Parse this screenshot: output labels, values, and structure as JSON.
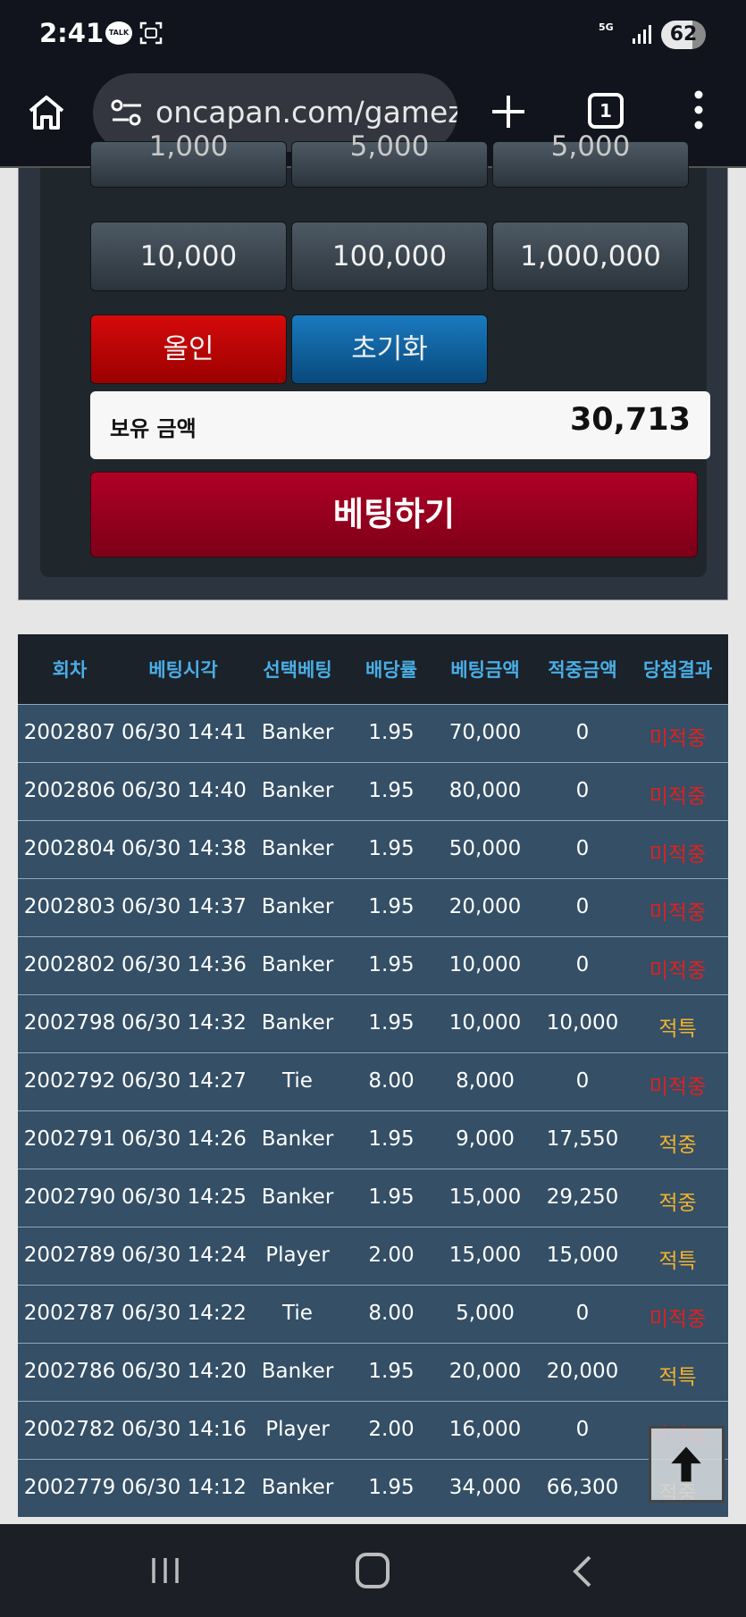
{
  "status_bar": {
    "time": "2:41",
    "talk_badge": "TALK",
    "network": "5G",
    "battery": "62"
  },
  "browser": {
    "url": "oncapan.com/gamez",
    "tab_count": "1"
  },
  "bet_panel": {
    "chip_top_row": [
      "1,000",
      "5,000",
      "5,000"
    ],
    "chip_row": [
      "10,000",
      "100,000",
      "1,000,000"
    ],
    "allin_label": "올인",
    "reset_label": "초기화",
    "balance_label": "보유 금액",
    "balance_value": "30,713",
    "bet_button_label": "베팅하기"
  },
  "history": {
    "columns": [
      "회차",
      "베팅시각",
      "선택베팅",
      "배당률",
      "베팅금액",
      "적중금액",
      "당첨결과"
    ],
    "rows": [
      [
        "2002807",
        "06/30 14:41",
        "Banker",
        "1.95",
        "70,000",
        "0",
        "미적중"
      ],
      [
        "2002806",
        "06/30 14:40",
        "Banker",
        "1.95",
        "80,000",
        "0",
        "미적중"
      ],
      [
        "2002804",
        "06/30 14:38",
        "Banker",
        "1.95",
        "50,000",
        "0",
        "미적중"
      ],
      [
        "2002803",
        "06/30 14:37",
        "Banker",
        "1.95",
        "20,000",
        "0",
        "미적중"
      ],
      [
        "2002802",
        "06/30 14:36",
        "Banker",
        "1.95",
        "10,000",
        "0",
        "미적중"
      ],
      [
        "2002798",
        "06/30 14:32",
        "Banker",
        "1.95",
        "10,000",
        "10,000",
        "적특"
      ],
      [
        "2002792",
        "06/30 14:27",
        "Tie",
        "8.00",
        "8,000",
        "0",
        "미적중"
      ],
      [
        "2002791",
        "06/30 14:26",
        "Banker",
        "1.95",
        "9,000",
        "17,550",
        "적중"
      ],
      [
        "2002790",
        "06/30 14:25",
        "Banker",
        "1.95",
        "15,000",
        "29,250",
        "적중"
      ],
      [
        "2002789",
        "06/30 14:24",
        "Player",
        "2.00",
        "15,000",
        "15,000",
        "적특"
      ],
      [
        "2002787",
        "06/30 14:22",
        "Tie",
        "8.00",
        "5,000",
        "0",
        "미적중"
      ],
      [
        "2002786",
        "06/30 14:20",
        "Banker",
        "1.95",
        "20,000",
        "20,000",
        "적특"
      ],
      [
        "2002782",
        "06/30 14:16",
        "Player",
        "2.00",
        "16,000",
        "0",
        "미적중"
      ],
      [
        "2002779",
        "06/30 14:12",
        "Banker",
        "1.95",
        "34,000",
        "66,300",
        "적중"
      ]
    ]
  },
  "colors": {
    "miss": "#e0211f",
    "hit": "#f2b22e",
    "header_text": "#4aaee6",
    "row_bg": "#344f66"
  }
}
